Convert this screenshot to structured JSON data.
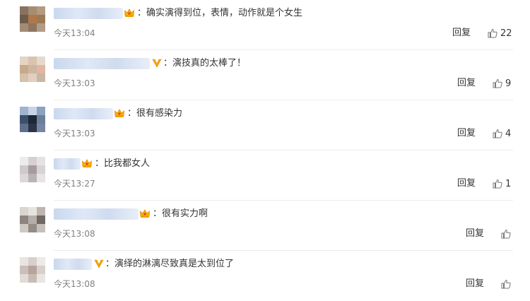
{
  "comments": [
    {
      "badge": "crown",
      "text": "：确实演得到位，表情，动作就是个女生",
      "time": "今天13:04",
      "reply": "回复",
      "likes": "22",
      "avatar": [
        "#8a7160",
        "#a58d70",
        "#b49a7e",
        "#6e5b4c",
        "#b0784a",
        "#9a7a55",
        "#a28a74",
        "#8e7560",
        "#b29c86"
      ]
    },
    {
      "badge": "v",
      "text": "：演技真的太棒了！",
      "time": "今天13:03",
      "reply": "回复",
      "likes": "9",
      "avatar": [
        "#e3d4c4",
        "#d9c4ae",
        "#e6d9cc",
        "#c9a88c",
        "#ceb7a0",
        "#e1b7a2",
        "#d6c1aa",
        "#e2cfbf",
        "#c9b6a4"
      ]
    },
    {
      "badge": "crown",
      "text": "：很有感染力",
      "time": "今天13:03",
      "reply": "回复",
      "likes": "4",
      "avatar": [
        "#9eb4cf",
        "#c7d4e6",
        "#8ba2c1",
        "#3d4f6a",
        "#1d2738",
        "#6c7f99",
        "#5d6f8b",
        "#2a3347",
        "#7486a1"
      ]
    },
    {
      "badge": "crown",
      "text": "：比我都女人",
      "time": "今天13:27",
      "reply": "回复",
      "likes": "1",
      "avatar": [
        "#ececec",
        "#d6d0d2",
        "#e4e2e3",
        "#cfc9cc",
        "#a79ba0",
        "#d8d4d6",
        "#dcd8da",
        "#b9b3b6",
        "#e6e4e5"
      ]
    },
    {
      "badge": "crown",
      "text": "：很有实力啊",
      "time": "今天13:08",
      "reply": "回复",
      "likes": "",
      "avatar": [
        "#d9d5d0",
        "#e6e3df",
        "#bdb5ae",
        "#8d8580",
        "#b6aea7",
        "#6f6863",
        "#cfc9c4",
        "#948c86",
        "#c7c0ba"
      ]
    },
    {
      "badge": "v",
      "text": "：演绎的淋漓尽致真是太到位了",
      "time": "今天13:08",
      "reply": "回复",
      "likes": "",
      "avatar": [
        "#e8e4e1",
        "#d8cfcb",
        "#ece9e7",
        "#cbbfb9",
        "#b5a49d",
        "#d9d0cc",
        "#e2dbd7",
        "#c9bbb4",
        "#e9e5e2"
      ]
    }
  ]
}
